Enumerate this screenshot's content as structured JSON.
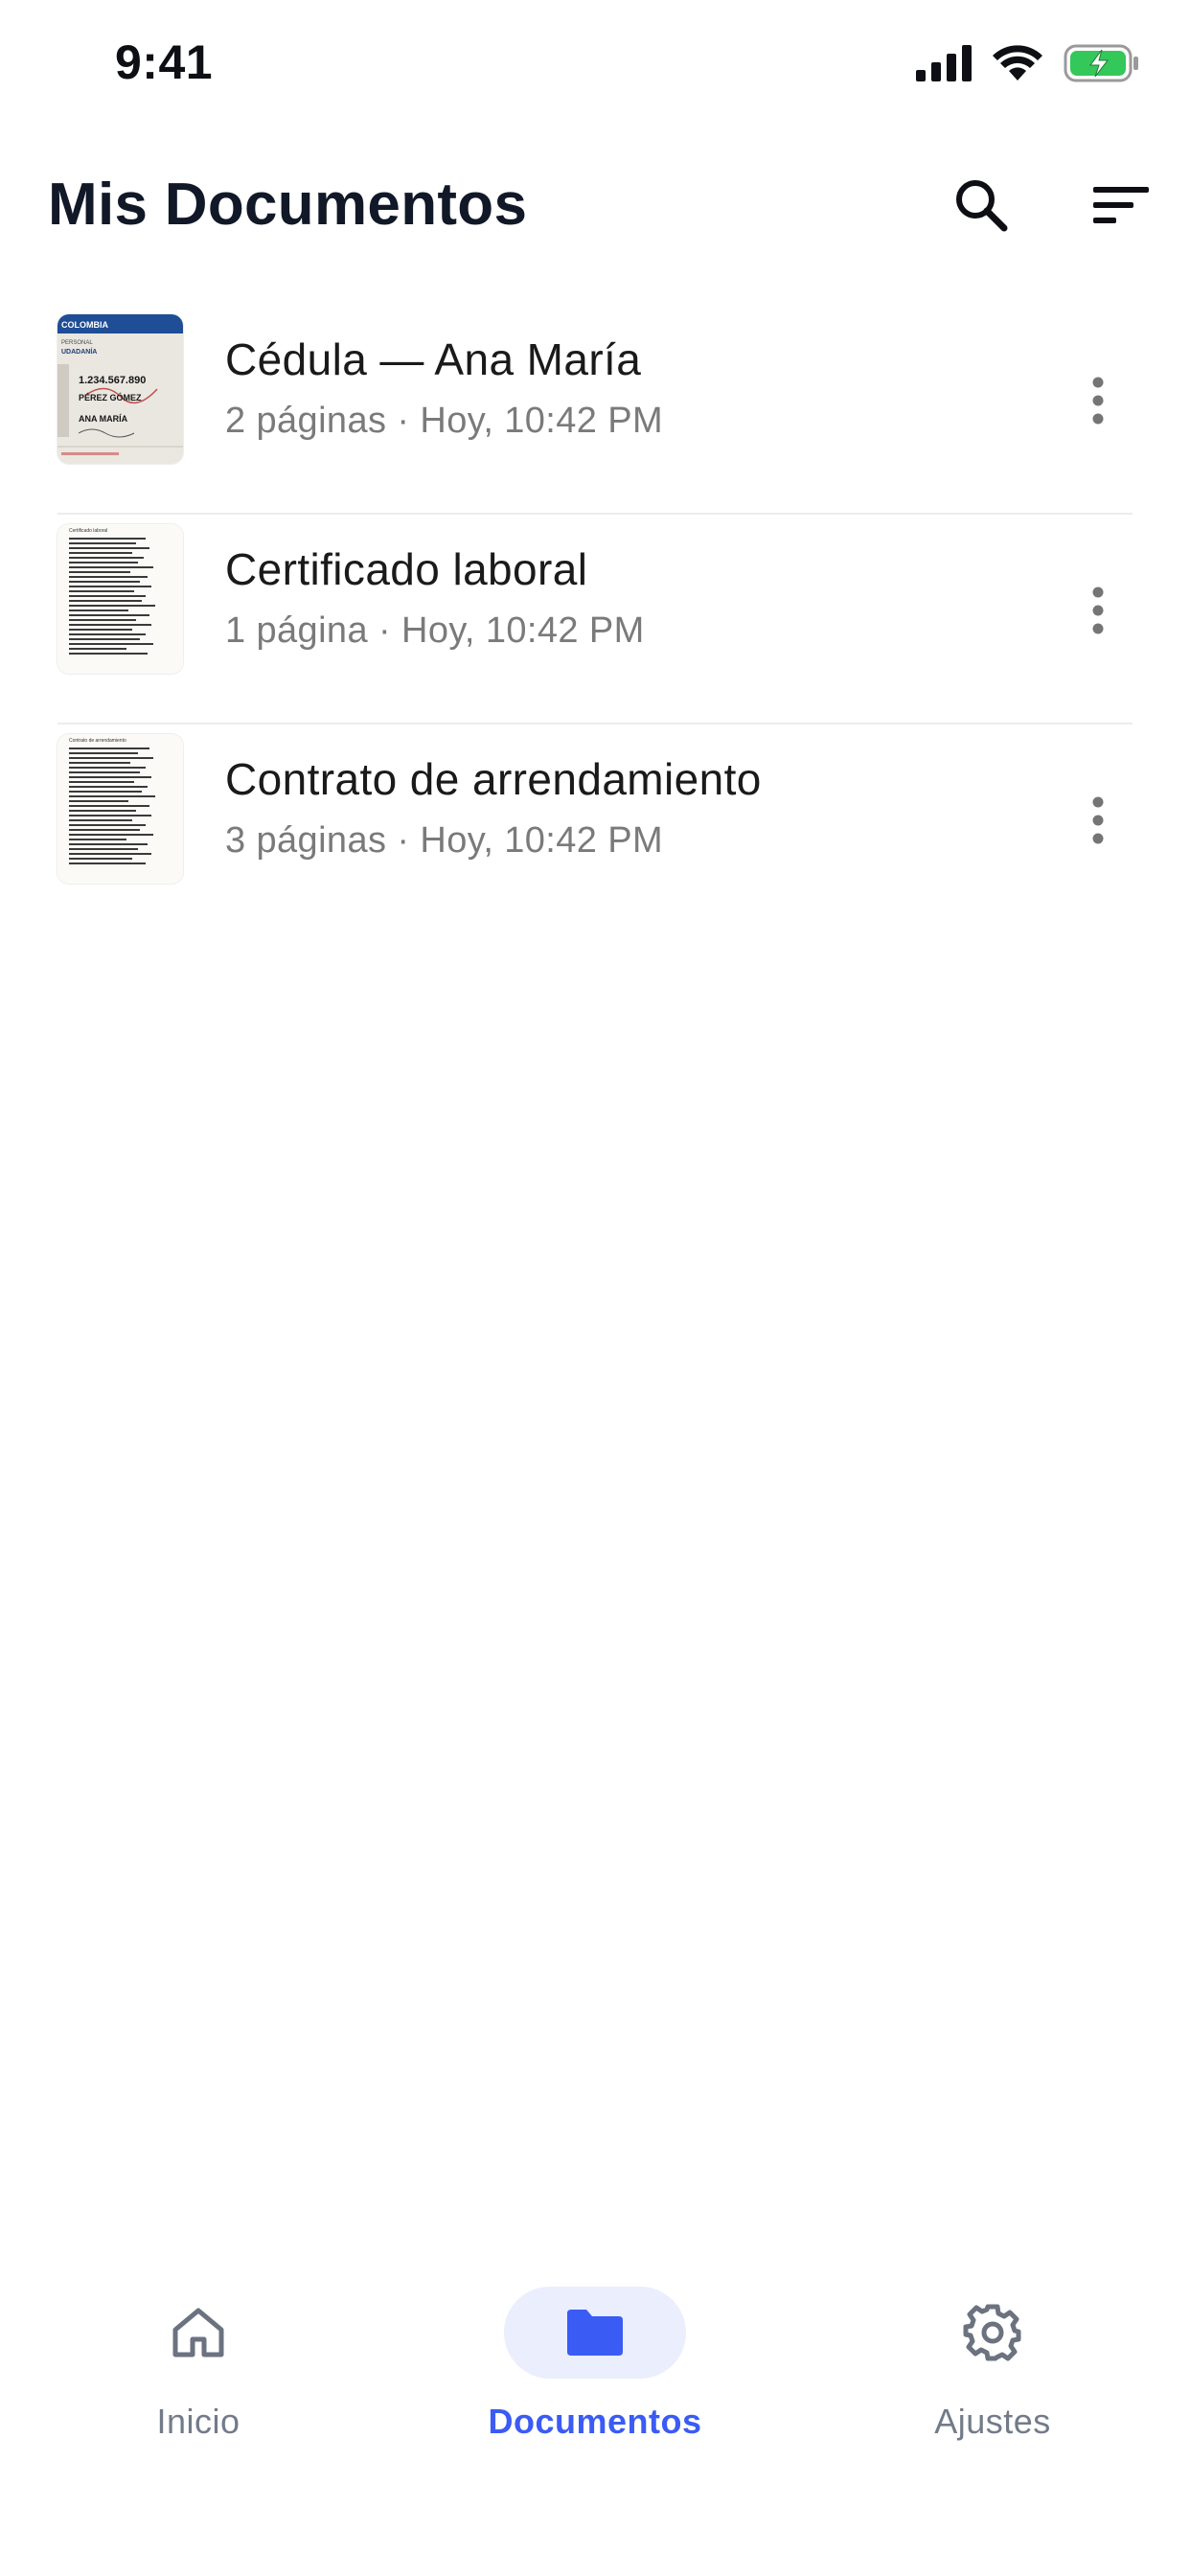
{
  "status_bar": {
    "time": "9:41"
  },
  "header": {
    "title": "Mis Documentos"
  },
  "documents": [
    {
      "title": "Cédula — Ana María",
      "meta": "2 páginas · Hoy, 10:42 PM"
    },
    {
      "title": "Certificado laboral",
      "meta": "1 página · Hoy, 10:42 PM"
    },
    {
      "title": "Contrato de arrendamiento",
      "meta": "3 páginas · Hoy, 10:42 PM"
    }
  ],
  "thumbnails": {
    "id_card": {
      "header": "COLOMBIA",
      "line1": "PERSONAL",
      "line2": "UDADANÍA",
      "number": "1.234.567.890",
      "surname": "PÉREZ GÓMEZ",
      "name": "ANA MARÍA"
    },
    "certificate": {
      "heading": "Certificado laboral"
    },
    "contract": {
      "heading": "Contrato de arrendamiento"
    }
  },
  "bottom_nav": {
    "items": [
      {
        "label": "Inicio",
        "icon": "home-icon"
      },
      {
        "label": "Documentos",
        "icon": "folder-icon",
        "active": true
      },
      {
        "label": "Ajustes",
        "icon": "gear-icon"
      }
    ]
  },
  "colors": {
    "accent": "#3b5bf5",
    "accent_bg": "#eaeefd",
    "battery": "#34c759",
    "text_primary": "#111827",
    "text_secondary": "#7a7a7a"
  }
}
